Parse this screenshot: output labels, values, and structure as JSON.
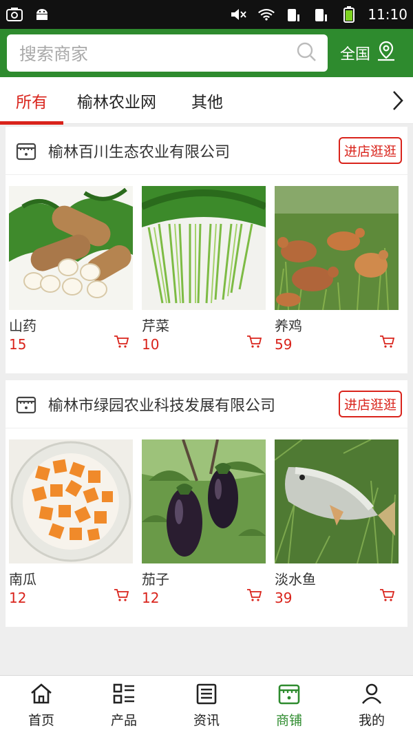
{
  "status_bar": {
    "time": "11:10"
  },
  "search": {
    "placeholder": "搜索商家"
  },
  "region": {
    "label": "全国"
  },
  "tabs": [
    {
      "label": "所有",
      "active": true
    },
    {
      "label": "榆林农业网",
      "active": false
    },
    {
      "label": "其他",
      "active": false
    }
  ],
  "shops": [
    {
      "name": "榆林百川生态农业有限公司",
      "visit_label": "进店逛逛",
      "products": [
        {
          "name": "山药",
          "price": "15",
          "image": "yam"
        },
        {
          "name": "芹菜",
          "price": "10",
          "image": "celery"
        },
        {
          "name": "养鸡",
          "price": "59",
          "image": "chickens"
        }
      ]
    },
    {
      "name": "榆林市绿园农业科技发展有限公司",
      "visit_label": "进店逛逛",
      "products": [
        {
          "name": "南瓜",
          "price": "12",
          "image": "pumpkin"
        },
        {
          "name": "茄子",
          "price": "12",
          "image": "eggplant"
        },
        {
          "name": "淡水鱼",
          "price": "39",
          "image": "fish"
        }
      ]
    }
  ],
  "bottom_nav": [
    {
      "label": "首页",
      "icon": "home-icon",
      "active": false
    },
    {
      "label": "产品",
      "icon": "list-icon",
      "active": false
    },
    {
      "label": "资讯",
      "icon": "news-icon",
      "active": false
    },
    {
      "label": "商铺",
      "icon": "shop-icon",
      "active": true
    },
    {
      "label": "我的",
      "icon": "user-icon",
      "active": false
    }
  ],
  "colors": {
    "brand_green": "#2e8b2e",
    "accent_red": "#d9231b"
  }
}
